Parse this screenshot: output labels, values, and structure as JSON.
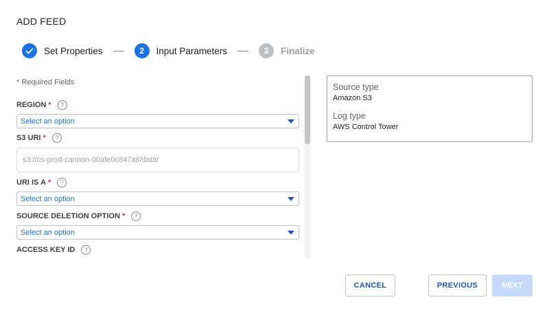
{
  "dialog": {
    "title": "ADD FEED"
  },
  "stepper": {
    "steps": [
      {
        "number": "",
        "label": "Set Properties",
        "state": "done"
      },
      {
        "number": "2",
        "label": "Input Parameters",
        "state": "active"
      },
      {
        "number": "3",
        "label": "Finalize",
        "state": "pending"
      }
    ]
  },
  "form": {
    "required_note": "* Required Fields",
    "required_marker": "*",
    "help_glyph": "?",
    "fields": {
      "region": {
        "label": "REGION",
        "value": "Select an option"
      },
      "s3_uri": {
        "label": "S3 URI",
        "value": "s3://cs-prod-cannon-00afe0c847a8/data/"
      },
      "uri_is_a": {
        "label": "URI IS A",
        "value": "Select an option"
      },
      "source_deletion": {
        "label": "SOURCE DELETION OPTION",
        "value": "Select an option"
      },
      "access_key_id": {
        "label": "ACCESS KEY ID"
      }
    }
  },
  "summary": {
    "source_type_label": "Source type",
    "source_type_value": "Amazon S3",
    "log_type_label": "Log type",
    "log_type_value": "AWS Control Tower"
  },
  "footer": {
    "cancel_label": "CANCEL",
    "previous_label": "PREVIOUS",
    "next_label": "NEXT"
  },
  "colors": {
    "accent": "#1a73e8",
    "disabled": "#c6dafc",
    "required": "#d93025"
  }
}
